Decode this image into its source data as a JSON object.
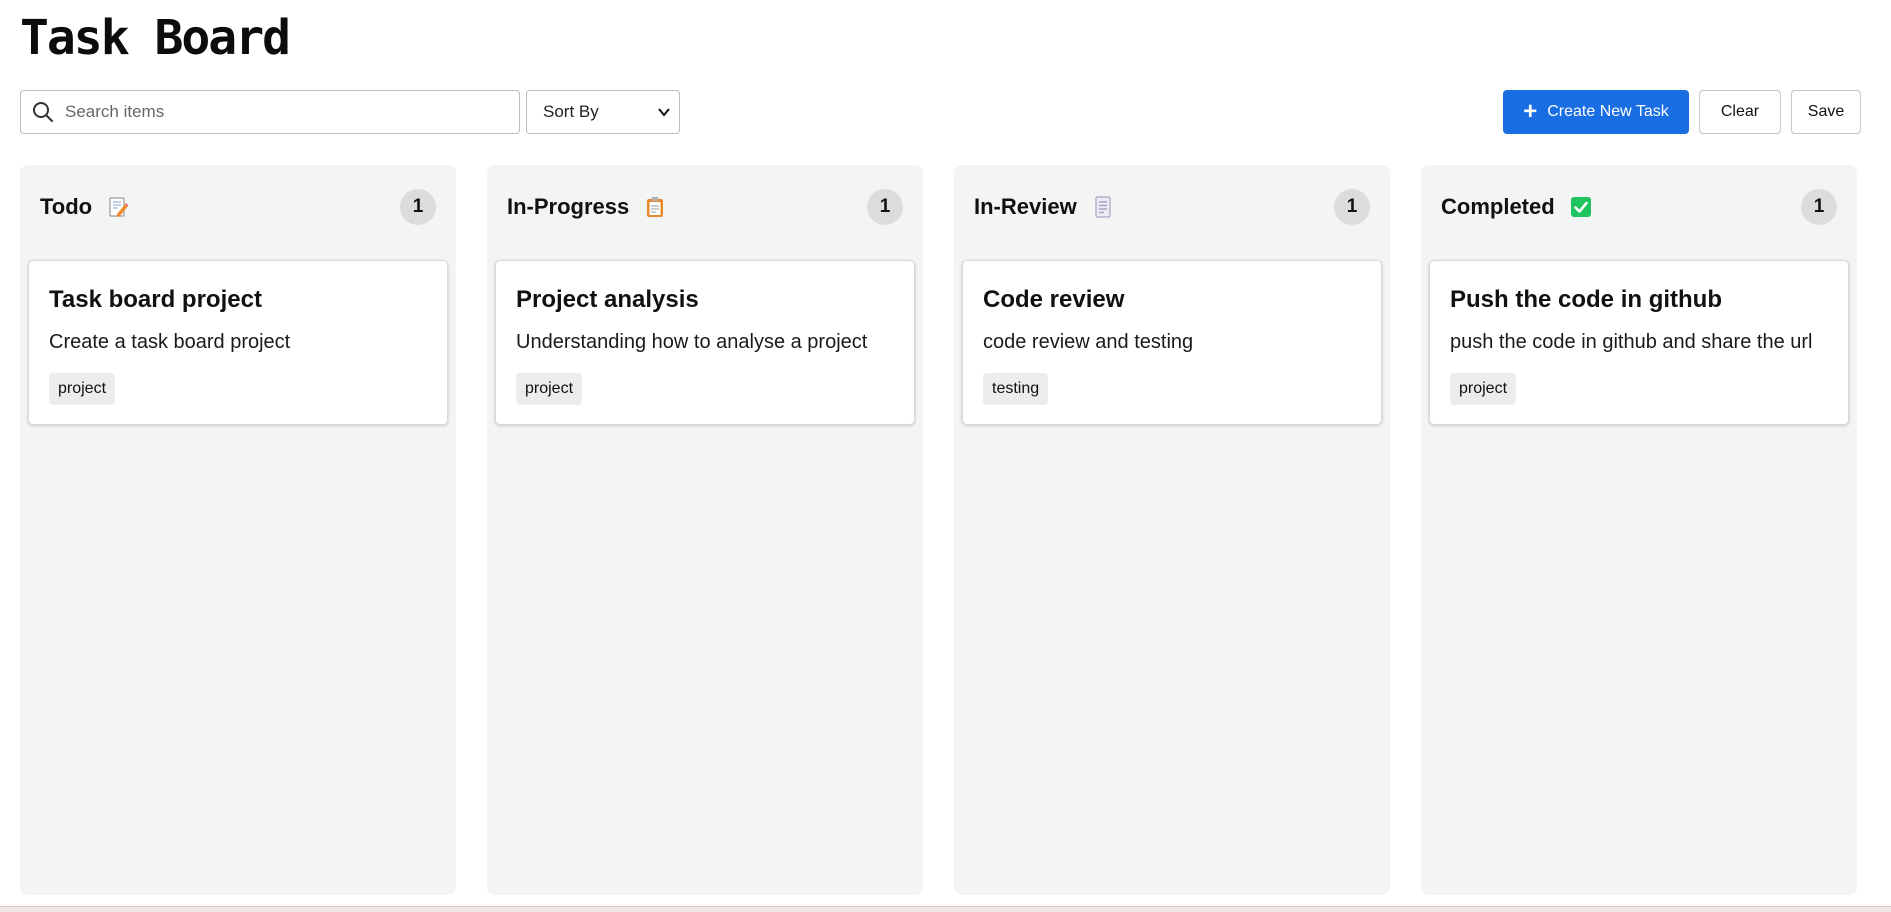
{
  "page": {
    "title": "Task Board"
  },
  "toolbar": {
    "search_placeholder": "Search items",
    "sort_label": "Sort By",
    "create_label": "Create New Task",
    "clear_label": "Clear",
    "save_label": "Save",
    "accent_color": "#1a6ee3"
  },
  "columns": [
    {
      "title": "Todo",
      "icon": "memo-pencil-icon",
      "count": "1",
      "cards": [
        {
          "title": "Task board project",
          "description": "Create a task board project",
          "tag": "project"
        }
      ]
    },
    {
      "title": "In-Progress",
      "icon": "clipboard-icon",
      "count": "1",
      "cards": [
        {
          "title": "Project analysis",
          "description": "Understanding how to analyse a project",
          "tag": "project"
        }
      ]
    },
    {
      "title": "In-Review",
      "icon": "document-icon",
      "count": "1",
      "cards": [
        {
          "title": "Code review",
          "description": "code review and testing",
          "tag": "testing"
        }
      ]
    },
    {
      "title": "Completed",
      "icon": "check-mark-button-icon",
      "count": "1",
      "cards": [
        {
          "title": "Push the code in github",
          "description": "push the code in github and share the url",
          "tag": "project"
        }
      ]
    }
  ]
}
